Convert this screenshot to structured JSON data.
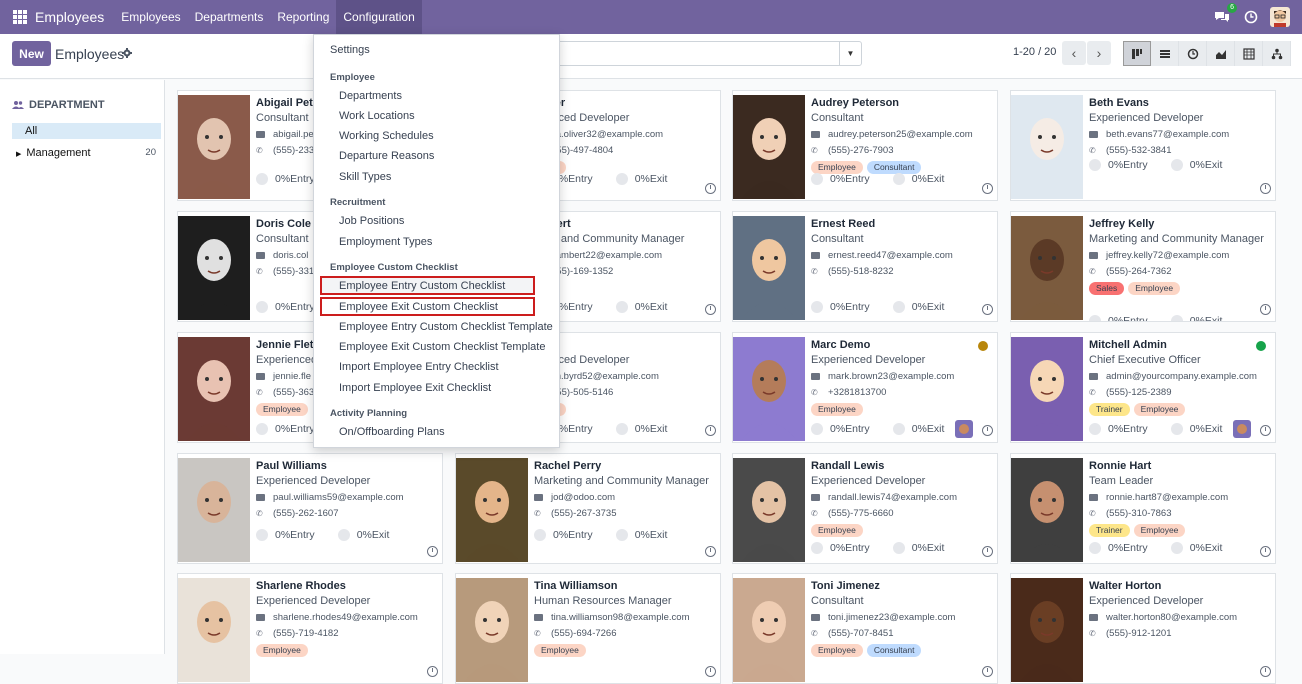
{
  "navbar": {
    "brand": "Employees",
    "menus": [
      "Employees",
      "Departments",
      "Reporting",
      "Configuration"
    ],
    "active_menu": "Configuration",
    "chat_count": "6"
  },
  "control": {
    "new_label": "New",
    "title": "Employees",
    "pager": "1-20 / 20",
    "views": [
      "kanban",
      "list",
      "activity",
      "graph",
      "pivot",
      "hierarchy"
    ]
  },
  "sidebar": {
    "heading": "DEPARTMENT",
    "all_label": "All",
    "items": [
      {
        "label": "Management",
        "count": "20"
      }
    ]
  },
  "dropdown": {
    "settings": "Settings",
    "section_employee": "Employee",
    "employee_items": [
      "Departments",
      "Work Locations",
      "Working Schedules",
      "Departure Reasons",
      "Skill Types"
    ],
    "section_recruitment": "Recruitment",
    "recruitment_items": [
      "Job Positions",
      "Employment Types"
    ],
    "section_checklist": "Employee Custom Checklist",
    "checklist_items": [
      "Employee Entry Custom Checklist",
      "Employee Exit Custom Checklist",
      "Employee Entry Custom Checklist Template",
      "Employee Exit Custom Checklist Template",
      "Import Employee Entry Checklist",
      "Import Employee Exit Checklist"
    ],
    "section_activity": "Activity Planning",
    "activity_items": [
      "On/Offboarding Plans"
    ]
  },
  "status": {
    "entry": "0%Entry",
    "exit": "0%Exit"
  },
  "colors": {
    "brand": "#71639e",
    "highlight": "#cc1d1d",
    "tag_employee": "#fcd5c5",
    "tag_consultant": "#bfdbfe",
    "tag_sales": "#f87171",
    "tag_trainer": "#fde68a"
  },
  "cards": [
    {
      "name": "Abigail Pet",
      "job": "Consultant",
      "email": "abigail.pe",
      "phone": "(555)-233",
      "tags": []
    },
    {
      "name": "Oliver",
      "job": "erienced Developer",
      "email": "ita.oliver32@example.com",
      "phone": "555)-497-4804",
      "tags": [
        "oyee"
      ]
    },
    {
      "name": "Audrey Peterson",
      "job": "Consultant",
      "email": "audrey.peterson25@example.com",
      "phone": "(555)-276-7903",
      "tags": [
        "Employee",
        "Consultant"
      ]
    },
    {
      "name": "Beth Evans",
      "job": "Experienced Developer",
      "email": "beth.evans77@example.com",
      "phone": "(555)-532-3841",
      "tags": []
    },
    {
      "name": "Doris Cole",
      "job": "Consultant",
      "email": "doris.col",
      "phone": "(555)-331",
      "tags": []
    },
    {
      "name": "ambert",
      "job": "eting and Community Manager",
      "email": ".lambert22@example.com",
      "phone": "555)-169-1352",
      "tags": []
    },
    {
      "name": "Ernest Reed",
      "job": "Consultant",
      "email": "ernest.reed47@example.com",
      "phone": "(555)-518-8232",
      "tags": []
    },
    {
      "name": "Jeffrey Kelly",
      "job": "Marketing and Community Manager",
      "email": "jeffrey.kelly72@example.com",
      "phone": "(555)-264-7362",
      "tags": [
        "Sales",
        "Employee"
      ]
    },
    {
      "name": "Jennie Flet",
      "job": "Experienced",
      "email": "jennie.fle",
      "phone": "(555)-363",
      "tags": [
        "Employee"
      ]
    },
    {
      "name": "Byrd",
      "job": "erienced Developer",
      "email": "ith.byrd52@example.com",
      "phone": "555)-505-5146",
      "tags": [
        "oyee"
      ]
    },
    {
      "name": "Marc Demo",
      "job": "Experienced Developer",
      "email": "mark.brown23@example.com",
      "phone": "+3281813700",
      "tags": [
        "Employee"
      ]
    },
    {
      "name": "Mitchell Admin",
      "job": "Chief Executive Officer",
      "email": "admin@yourcompany.example.com",
      "phone": "(555)-125-2389",
      "tags": [
        "Trainer",
        "Employee"
      ]
    },
    {
      "name": "Paul Williams",
      "job": "Experienced Developer",
      "email": "paul.williams59@example.com",
      "phone": "(555)-262-1607",
      "tags": []
    },
    {
      "name": "Rachel Perry",
      "job": "Marketing and Community Manager",
      "email": "jod@odoo.com",
      "phone": "(555)-267-3735",
      "tags": []
    },
    {
      "name": "Randall Lewis",
      "job": "Experienced Developer",
      "email": "randall.lewis74@example.com",
      "phone": "(555)-775-6660",
      "tags": [
        "Employee"
      ]
    },
    {
      "name": "Ronnie Hart",
      "job": "Team Leader",
      "email": "ronnie.hart87@example.com",
      "phone": "(555)-310-7863",
      "tags": [
        "Trainer",
        "Employee"
      ]
    },
    {
      "name": "Sharlene Rhodes",
      "job": "Experienced Developer",
      "email": "sharlene.rhodes49@example.com",
      "phone": "(555)-719-4182",
      "tags": [
        "Employee"
      ]
    },
    {
      "name": "Tina Williamson",
      "job": "Human Resources Manager",
      "email": "tina.williamson98@example.com",
      "phone": "(555)-694-7266",
      "tags": [
        "Employee"
      ]
    },
    {
      "name": "Toni Jimenez",
      "job": "Consultant",
      "email": "toni.jimenez23@example.com",
      "phone": "(555)-707-8451",
      "tags": [
        "Employee",
        "Consultant"
      ]
    },
    {
      "name": "Walter Horton",
      "job": "Experienced Developer",
      "email": "walter.horton80@example.com",
      "phone": "(555)-912-1201",
      "tags": []
    }
  ]
}
